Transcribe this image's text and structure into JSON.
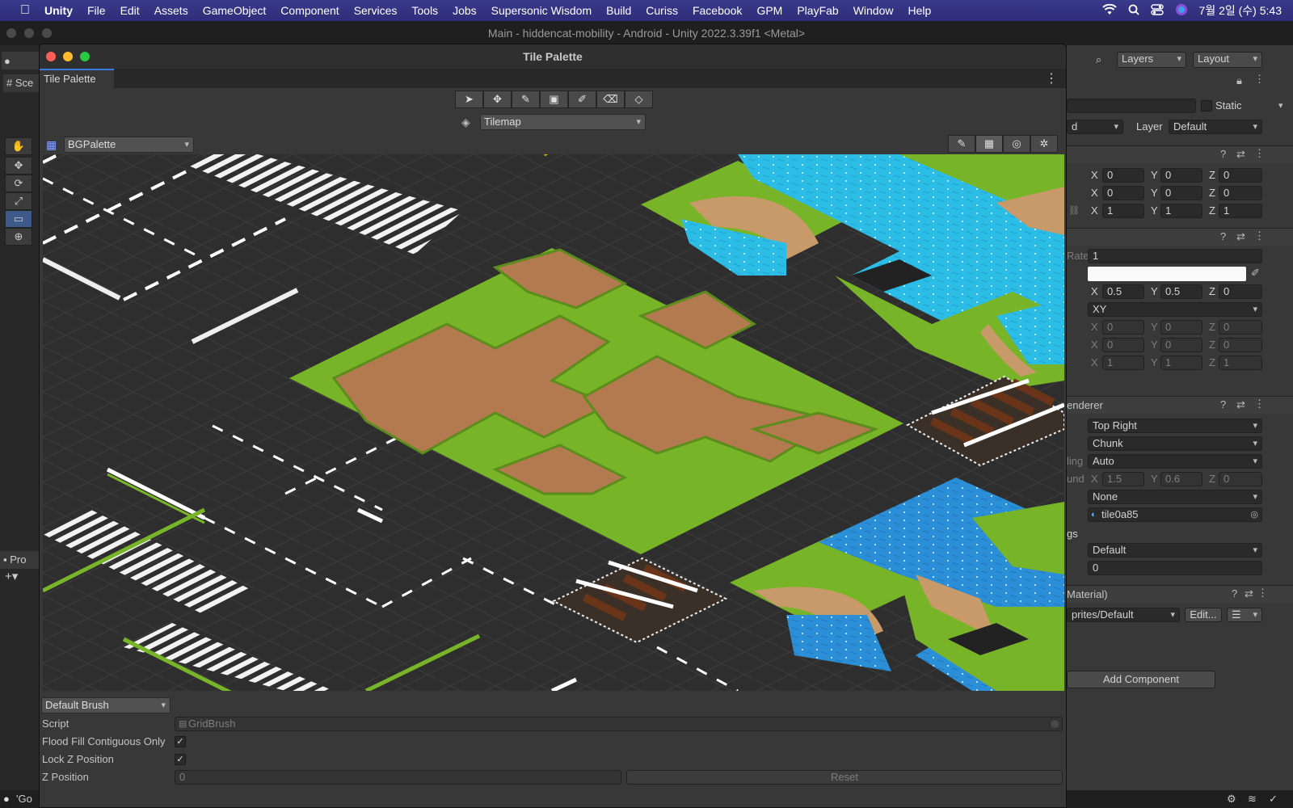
{
  "menubar": {
    "app": "Unity",
    "items": [
      "File",
      "Edit",
      "Assets",
      "GameObject",
      "Component",
      "Services",
      "Tools",
      "Jobs",
      "Supersonic Wisdom",
      "Build",
      "Curiss",
      "Facebook",
      "GPM",
      "PlayFab",
      "Window",
      "Help"
    ],
    "clock": "7월 2일 (수) 5:43",
    "icons": [
      "apple-icon",
      "wifi-icon",
      "search-icon",
      "control-center-icon",
      "siri-icon"
    ]
  },
  "main_window": {
    "title": "Main - hiddencat-mobility - Android - Unity 2022.3.39f1 <Metal>"
  },
  "editor_bg": {
    "scene_tab": "Sce",
    "project_tab": "Pro",
    "bottom_text": "'Go",
    "left_tools": [
      "✋",
      "✥",
      "⟳",
      "⤢",
      "▭",
      "⊕"
    ]
  },
  "tile_palette": {
    "window_title": "Tile Palette",
    "tab_label": "Tile Palette",
    "tools": [
      "select-tool",
      "move-tool",
      "paint-tool",
      "box-fill-tool",
      "picker-tool",
      "erase-tool",
      "fill-tool"
    ],
    "tool_glyphs": [
      "➤",
      "✥",
      "✎",
      "▣",
      "✐",
      "⌫",
      "◇"
    ],
    "active_target": "Tilemap",
    "palette": "BGPalette",
    "view_tools": [
      "edit-icon",
      "grid-icon",
      "gizmo-icon",
      "palette-settings-icon"
    ],
    "view_glyphs": [
      "✎",
      "▦",
      "◎",
      "✲"
    ],
    "brush": "Default Brush",
    "brush_props": {
      "script_label": "Script",
      "script_value": "GridBrush",
      "flood_label": "Flood Fill Contiguous Only",
      "flood_checked": true,
      "lockz_label": "Lock Z Position",
      "lockz_checked": true,
      "zpos_label": "Z Position",
      "zpos_value": "0",
      "reset_label": "Reset"
    }
  },
  "inspector": {
    "toolbar": {
      "layers": "Layers",
      "layout": "Layout"
    },
    "static_label": "Static",
    "tag_partial": "d",
    "layer_label": "Layer",
    "layer_value": "Default",
    "transform": {
      "rows": [
        {
          "x": "0",
          "y": "0",
          "z": "0"
        },
        {
          "x": "0",
          "y": "0",
          "z": "0"
        },
        {
          "x": "1",
          "y": "1",
          "z": "1"
        }
      ]
    },
    "tilemap": {
      "rate_label": "Rate",
      "rate_value": "1",
      "anchor": {
        "x": "0.5",
        "y": "0.5",
        "z": "0"
      },
      "orientation": "XY",
      "offset": {
        "x": "0",
        "y": "0",
        "z": "0"
      },
      "rotation": {
        "x": "0",
        "y": "0",
        "z": "0"
      },
      "scale": {
        "x": "1",
        "y": "1",
        "z": "1"
      }
    },
    "renderer": {
      "header": "enderer",
      "sort_order": "Top Right",
      "mode": "Chunk",
      "detect_label": "ling",
      "detect_value": "Auto",
      "bounds_label": "und",
      "bounds": {
        "x": "1.5",
        "y": "0.6",
        "z": "0"
      },
      "mask": "None",
      "sprite": "tile0a85",
      "sorting_label": "gs",
      "sorting_layer": "Default",
      "order": "0"
    },
    "material": {
      "header": "Material)",
      "value": "prites/Default",
      "edit_label": "Edit..."
    },
    "add_component": "Add Component"
  },
  "colors": {
    "road": "#2f2f2f",
    "grass": "#78b428",
    "dirt": "#b27a4e",
    "water": "#29b6e0",
    "water_dark": "#2a8fd6",
    "accent": "#3d7ae0"
  }
}
